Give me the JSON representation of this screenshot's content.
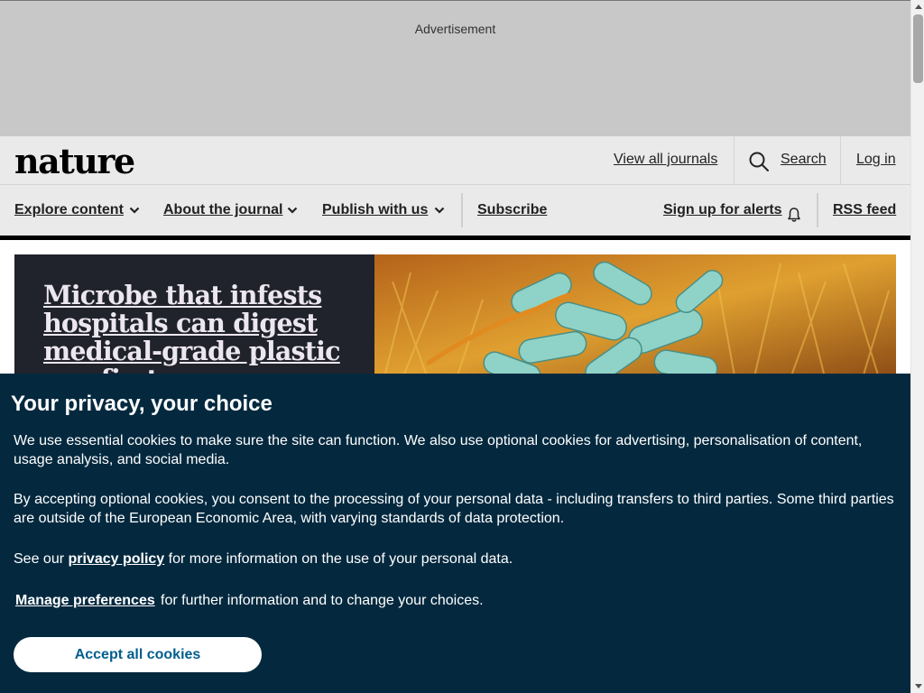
{
  "ad": {
    "label": "Advertisement"
  },
  "header": {
    "logo": "nature",
    "view_all_journals": "View all journals",
    "search": "Search",
    "login": "Log in"
  },
  "nav": {
    "items": [
      {
        "label": "Explore content"
      },
      {
        "label": "About the journal"
      },
      {
        "label": "Publish with us"
      },
      {
        "label": "Subscribe"
      }
    ],
    "alerts": "Sign up for alerts",
    "rss": "RSS feed"
  },
  "hero": {
    "title": "Microbe that infests hospitals can digest medical-grade plastic — a first"
  },
  "cookie": {
    "title": "Your privacy, your choice",
    "p1": "We use essential cookies to make sure the site can function. We also use optional cookies for advertising, personalisation of content, usage analysis, and social media.",
    "p2": "By accepting optional cookies, you consent to the processing of your personal data - including transfers to third parties. Some third parties are outside of the European Economic Area, with varying standards of data protection.",
    "p3_before": "See our ",
    "p3_link": "privacy policy",
    "p3_after": " for more information on the use of your personal data.",
    "manage": "Manage preferences",
    "manage_rest": "for further information and to change your choices.",
    "accept": "Accept all cookies"
  },
  "colors": {
    "cookie_bg": "#04293f",
    "accept_text": "#025e8d",
    "hero_dark": "#20232c",
    "header_bg": "#eaeaea",
    "ad_bg": "#c8c8c8"
  },
  "icons": [
    "search-icon",
    "chevron-down-icon",
    "bell-icon"
  ]
}
